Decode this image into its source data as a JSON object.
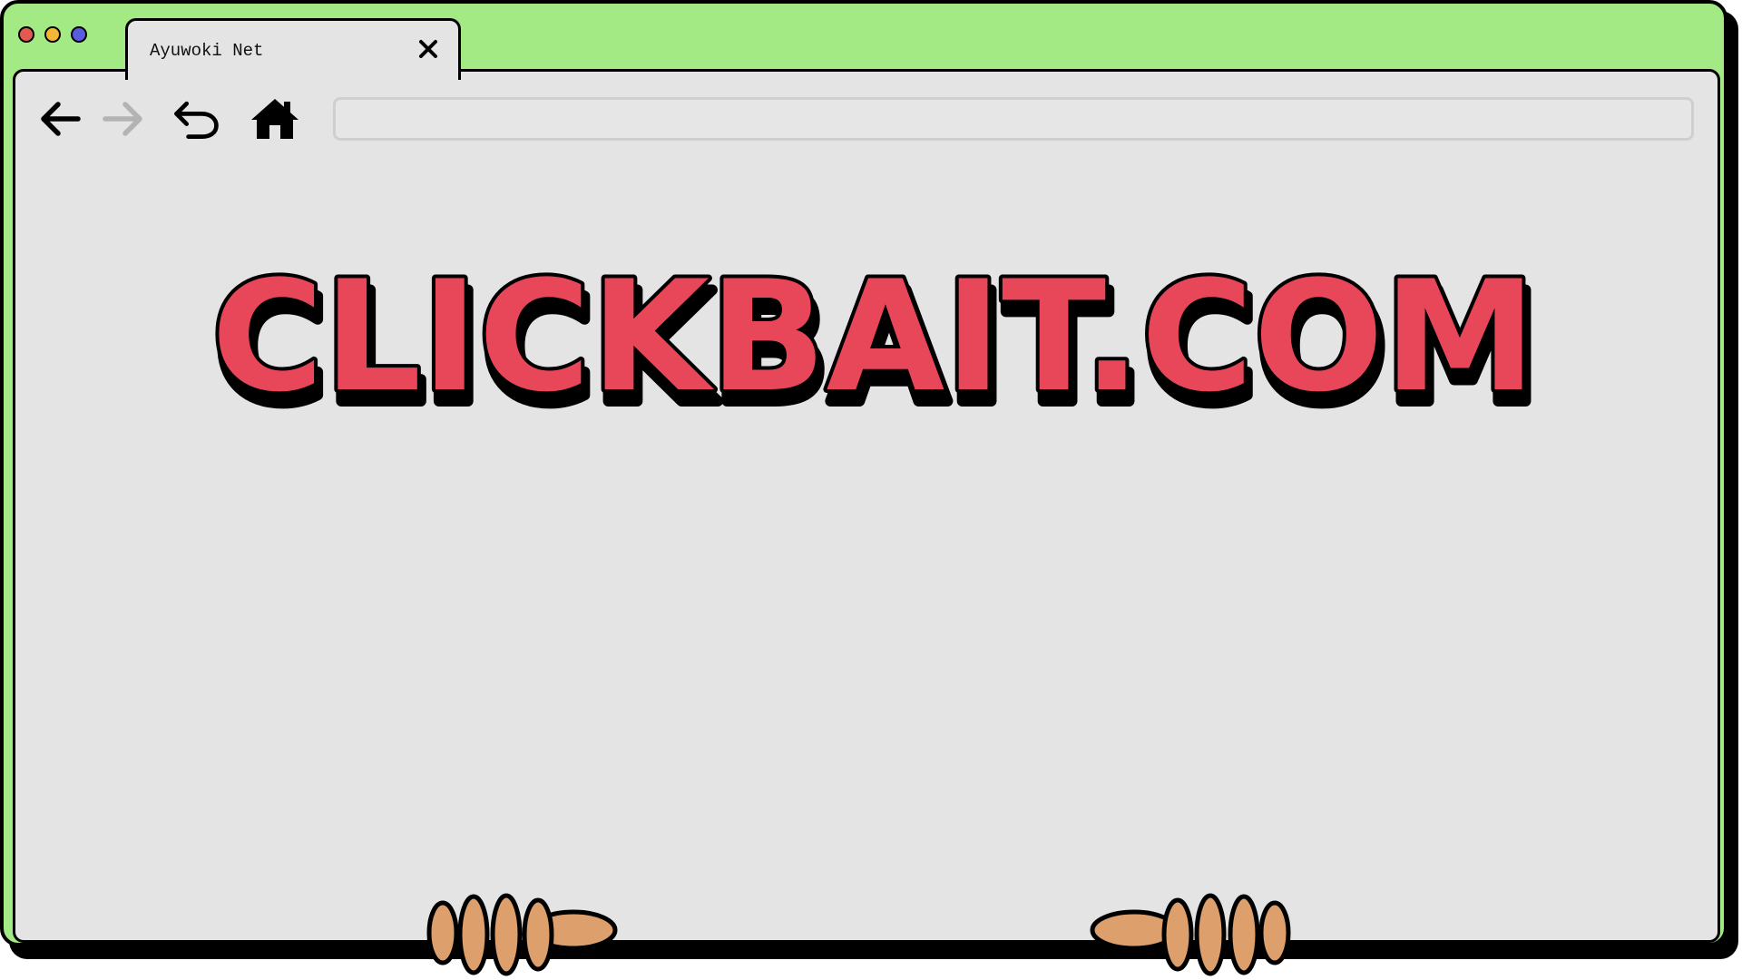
{
  "window": {
    "traffic_lights": [
      {
        "name": "close",
        "color": "#e25a4f"
      },
      {
        "name": "minimize",
        "color": "#f2b734"
      },
      {
        "name": "maximize",
        "color": "#5a5ce0"
      }
    ],
    "frame_color": "#a3ea84"
  },
  "tab": {
    "title": "Ayuwoki Net",
    "close_icon": "close-icon"
  },
  "toolbar": {
    "back_icon": "arrow-left-icon",
    "forward_icon": "arrow-right-icon",
    "forward_enabled": false,
    "reload_icon": "undo-icon",
    "home_icon": "home-icon",
    "address_value": "",
    "address_placeholder": ""
  },
  "page": {
    "logo_text": "CLICKBAIT.COM",
    "logo_fill": "#e8475a",
    "logo_outline": "#000000",
    "background": "#e4e4e4"
  },
  "decoration": {
    "hands_color": "#dda06c"
  }
}
